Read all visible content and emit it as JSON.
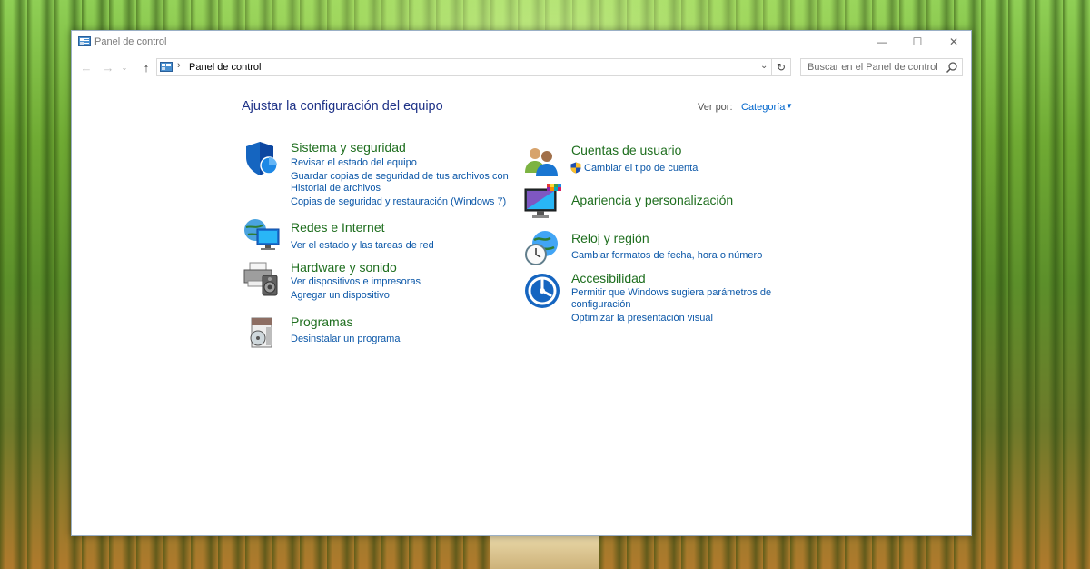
{
  "window": {
    "title": "Panel de control"
  },
  "controls": {
    "minimize": "—",
    "maximize": "☐",
    "close": "✕"
  },
  "nav": {
    "back": "←",
    "forward": "→",
    "history": "⌄",
    "up": "↑",
    "breadcrumb_separator": "›",
    "address": "Panel de control",
    "address_dropdown": "⌄",
    "refresh": "↻",
    "search_placeholder": "Buscar en el Panel de control"
  },
  "page": {
    "heading": "Ajustar la configuración del equipo",
    "view_by_label": "Ver por:",
    "view_by_value": "Categoría",
    "view_by_arrow": "▼"
  },
  "categories": [
    {
      "title": "Sistema y seguridad",
      "icon": "shield-icon",
      "links": [
        "Revisar el estado del equipo",
        "Guardar copias de seguridad de tus archivos con",
        "Historial de archivos",
        "Copias de seguridad y restauración (Windows 7)"
      ]
    },
    {
      "title": "Redes e Internet",
      "icon": "network-globe-icon",
      "links": [
        "Ver el estado y las tareas de red"
      ]
    },
    {
      "title": "Hardware y sonido",
      "icon": "printer-speaker-icon",
      "links": [
        "Ver dispositivos e impresoras",
        "Agregar un dispositivo"
      ]
    },
    {
      "title": "Programas",
      "icon": "programs-disc-icon",
      "links": [
        "Desinstalar un programa"
      ]
    },
    {
      "title": "Cuentas de usuario",
      "icon": "users-icon",
      "links": [
        "Cambiar el tipo de cuenta"
      ]
    },
    {
      "title": "Apariencia y personalización",
      "icon": "monitor-palette-icon",
      "links": []
    },
    {
      "title": "Reloj y región",
      "icon": "clock-globe-icon",
      "links": [
        "Cambiar formatos de fecha, hora o número"
      ]
    },
    {
      "title": "Accesibilidad",
      "icon": "accessibility-icon",
      "links": [
        "Permitir que Windows sugiera parámetros de",
        "configuración",
        "Optimizar la presentación visual"
      ]
    }
  ],
  "colors": {
    "heading": "#1e3287",
    "category_title": "#1e6e1e",
    "link": "#0b57a8"
  }
}
